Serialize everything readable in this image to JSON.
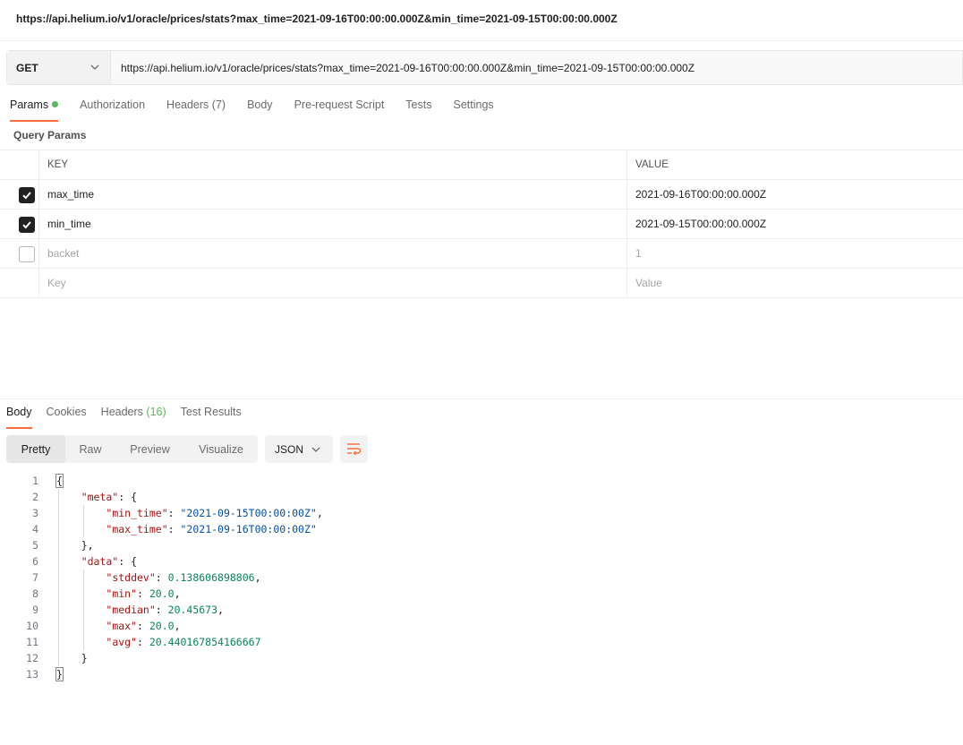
{
  "title": "https://api.helium.io/v1/oracle/prices/stats?max_time=2021-09-16T00:00:00.000Z&min_time=2021-09-15T00:00:00.000Z",
  "request": {
    "method": "GET",
    "url": "https://api.helium.io/v1/oracle/prices/stats?max_time=2021-09-16T00:00:00.000Z&min_time=2021-09-15T00:00:00.000Z"
  },
  "request_tabs": {
    "params": "Params",
    "authorization": "Authorization",
    "headers": "Headers",
    "headers_count": "(7)",
    "body": "Body",
    "pre_request_script": "Pre-request Script",
    "tests": "Tests",
    "settings": "Settings"
  },
  "query_params": {
    "title": "Query Params",
    "header_key": "KEY",
    "header_value": "VALUE",
    "rows": [
      {
        "key": "max_time",
        "value": "2021-09-16T00:00:00.000Z",
        "checked": true
      },
      {
        "key": "min_time",
        "value": "2021-09-15T00:00:00.000Z",
        "checked": true
      },
      {
        "key": "backet",
        "value": "1",
        "checked": false
      }
    ],
    "new_key_placeholder": "Key",
    "new_value_placeholder": "Value"
  },
  "response_tabs": {
    "body": "Body",
    "cookies": "Cookies",
    "headers": "Headers",
    "headers_count": "(16)",
    "test_results": "Test Results"
  },
  "view_modes": {
    "pretty": "Pretty",
    "raw": "Raw",
    "preview": "Preview",
    "visualize": "Visualize",
    "format": "JSON"
  },
  "response_body": {
    "line_numbers": [
      "1",
      "2",
      "3",
      "4",
      "5",
      "6",
      "7",
      "8",
      "9",
      "10",
      "11",
      "12",
      "13"
    ],
    "meta_key": "\"meta\"",
    "min_time_key": "\"min_time\"",
    "min_time_value": "\"2021-09-15T00:00:00Z\"",
    "max_time_key": "\"max_time\"",
    "max_time_value": "\"2021-09-16T00:00:00Z\"",
    "data_key": "\"data\"",
    "stddev_key": "\"stddev\"",
    "stddev_value": "0.138606898806",
    "min_key": "\"min\"",
    "min_value": "20.0",
    "median_key": "\"median\"",
    "median_value": "20.45673",
    "max_key": "\"max\"",
    "max_value": "20.0",
    "avg_key": "\"avg\"",
    "avg_value": "20.440167854166667"
  },
  "colors": {
    "accent": "#ff6c37",
    "status_dot": "#5cb85c",
    "json_key": "#a31515",
    "json_string": "#0451a5",
    "json_number": "#098658"
  },
  "icons": [
    "chevron-down-icon",
    "checkmark-icon",
    "wrap-lines-icon"
  ]
}
